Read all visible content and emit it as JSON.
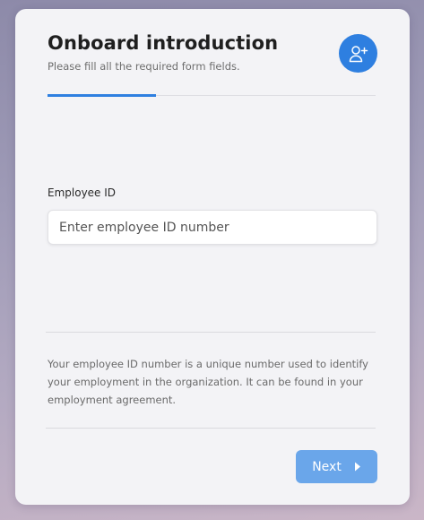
{
  "header": {
    "title": "Onboard introduction",
    "subtitle": "Please fill all the required form fields.",
    "avatar_icon": "add-user-icon"
  },
  "progress": {
    "fraction": 0.33
  },
  "form": {
    "employee_id": {
      "label": "Employee ID",
      "value": "",
      "placeholder": "Enter employee ID number"
    }
  },
  "help": {
    "text": "Your employee ID number is a unique number used to identify your employment in the organization. It can be found in your employment agreement."
  },
  "footer": {
    "next_label": "Next",
    "next_icon": "chevron-right-icon"
  },
  "colors": {
    "accent": "#2e7fe0",
    "button_disabled": "#6aa6ea",
    "card_bg": "#f3f3f6"
  }
}
